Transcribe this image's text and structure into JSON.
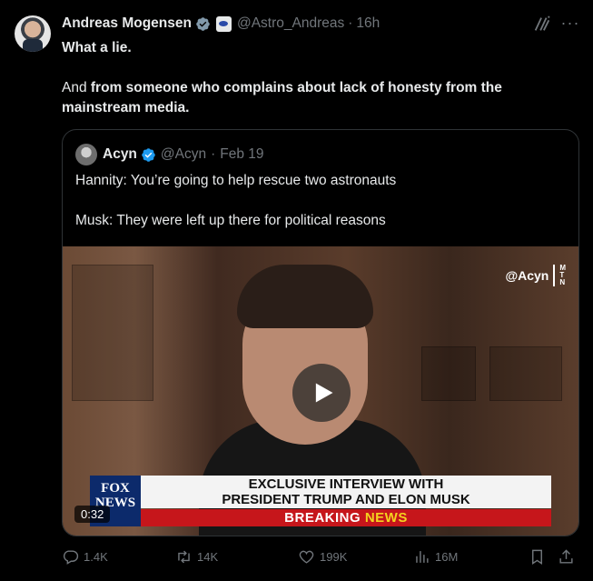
{
  "tweet": {
    "author_name": "Andreas Mogensen",
    "author_handle": "@Astro_Andreas",
    "separator": "·",
    "timestamp": "16h",
    "more_label": "···",
    "text_line1": "What a lie.",
    "text_and": "And ",
    "text_rest": "from someone who complains about lack of honesty from the mainstream media."
  },
  "quote": {
    "author_name": "Acyn",
    "author_handle": "@Acyn",
    "separator": "·",
    "date": "Feb 19",
    "line1": "Hannity: You’re going to help rescue two astronauts",
    "line2": "Musk: They were left up there for political reasons"
  },
  "video": {
    "watermark": "@Acyn",
    "watermark_m": "M",
    "watermark_t": "T",
    "watermark_n": "N",
    "logo_line1": "FOX",
    "logo_line2": "NEWS",
    "banner_line1": "EXCLUSIVE INTERVIEW WITH",
    "banner_line2": "PRESIDENT TRUMP AND ELON MUSK",
    "breaking_word": "BREAKING ",
    "news_word": "NEWS",
    "timecode": "0:32"
  },
  "actions": {
    "replies": "1.4K",
    "reposts": "14K",
    "likes": "199K",
    "views": "16M"
  },
  "colors": {
    "background": "#000000",
    "text": "#e7e9ea",
    "muted": "#71767b",
    "verified_blue": "#1d9bf0",
    "verified_gray": "#829aab",
    "breaking_red": "#c6161b"
  }
}
